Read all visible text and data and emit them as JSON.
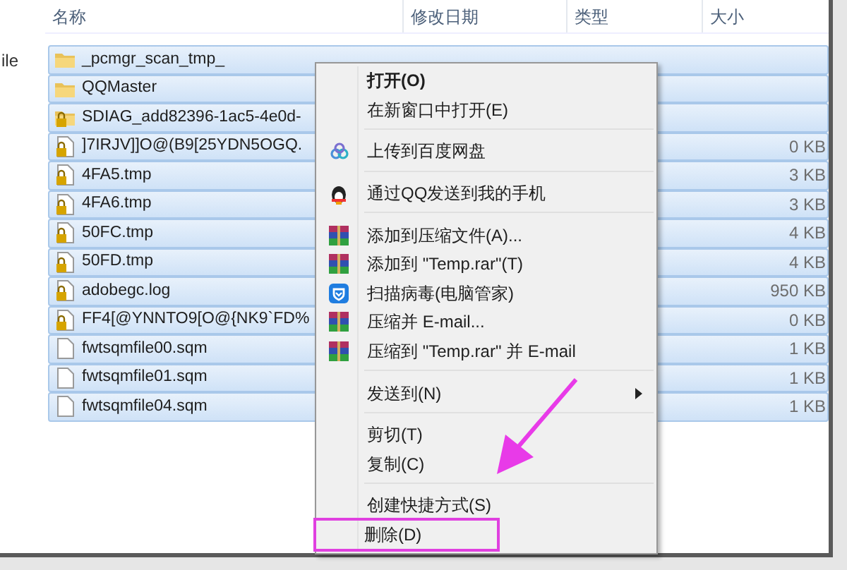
{
  "left_pane": {
    "text": "ile"
  },
  "columns": [
    "名称",
    "修改日期",
    "类型",
    "大小"
  ],
  "rows": [
    {
      "kind": "folder",
      "name": "_pcmgr_scan_tmp_",
      "selected": true
    },
    {
      "kind": "folder",
      "name": "QQMaster",
      "selected": true
    },
    {
      "kind": "locked-folder",
      "name": "SDIAG_add82396-1ac5-4e0d-",
      "selected": true
    },
    {
      "kind": "locked-file",
      "name": "]7IRJV]]O@(B9[25YDN5OGQ.",
      "size": "0 KB",
      "selected": true
    },
    {
      "kind": "locked-file",
      "name": "4FA5.tmp",
      "size": "3 KB",
      "selected": true
    },
    {
      "kind": "locked-file",
      "name": "4FA6.tmp",
      "size": "3 KB",
      "selected": true
    },
    {
      "kind": "locked-file",
      "name": "50FC.tmp",
      "size": "4 KB",
      "selected": true
    },
    {
      "kind": "locked-file",
      "name": "50FD.tmp",
      "size": "4 KB",
      "selected": true
    },
    {
      "kind": "locked-file",
      "name": "adobegc.log",
      "size": "950 KB",
      "selected": true
    },
    {
      "kind": "locked-file",
      "name": "FF4[@YNNTO9[O@{NK9`FD%",
      "size": "0 KB",
      "selected": true
    },
    {
      "kind": "file",
      "name": "fwtsqmfile00.sqm",
      "size": "1 KB",
      "selected": true
    },
    {
      "kind": "file",
      "name": "fwtsqmfile01.sqm",
      "size": "1 KB",
      "selected": true
    },
    {
      "kind": "file",
      "name": "fwtsqmfile04.sqm",
      "size": "1 KB",
      "selected": true
    }
  ],
  "context_menu": [
    {
      "kind": "plain",
      "label": "打开(O)",
      "bold": true
    },
    {
      "kind": "plain",
      "label": "在新窗口中打开(E)"
    },
    {
      "kind": "separator"
    },
    {
      "kind": "cloud",
      "label": "上传到百度网盘"
    },
    {
      "kind": "separator"
    },
    {
      "kind": "penguin",
      "label": "通过QQ发送到我的手机"
    },
    {
      "kind": "separator"
    },
    {
      "kind": "archive",
      "label": "添加到压缩文件(A)..."
    },
    {
      "kind": "archive",
      "label": "添加到 \"Temp.rar\"(T)"
    },
    {
      "kind": "shield",
      "label": "扫描病毒(电脑管家)"
    },
    {
      "kind": "archive",
      "label": "压缩并 E-mail..."
    },
    {
      "kind": "archive",
      "label": "压缩到 \"Temp.rar\" 并 E-mail"
    },
    {
      "kind": "separator"
    },
    {
      "kind": "plain",
      "label": "发送到(N)",
      "submenu": true
    },
    {
      "kind": "separator"
    },
    {
      "kind": "plain",
      "label": "剪切(T)"
    },
    {
      "kind": "plain",
      "label": "复制(C)"
    },
    {
      "kind": "separator"
    },
    {
      "kind": "plain",
      "label": "创建快捷方式(S)"
    },
    {
      "kind": "plain",
      "label": "删除(D)",
      "boxed": true
    }
  ],
  "arrow_annotation": true
}
